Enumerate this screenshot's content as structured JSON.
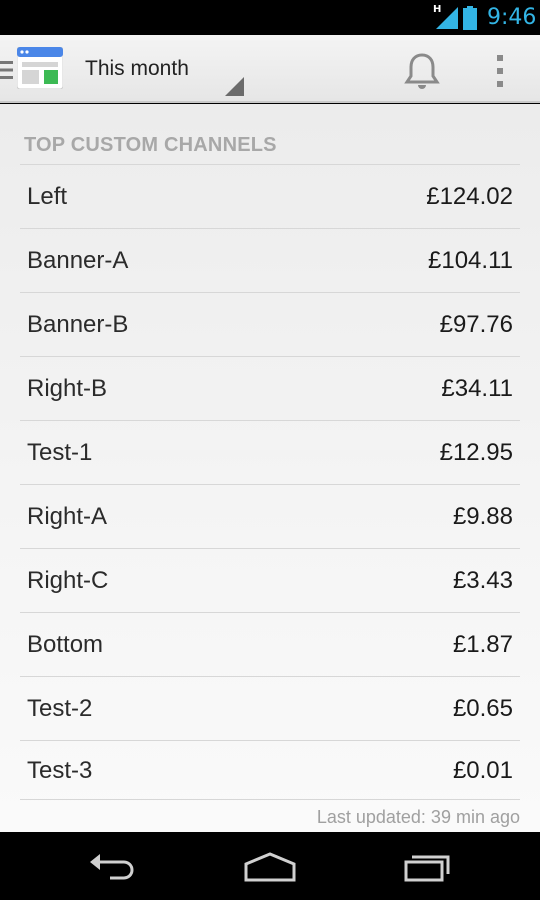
{
  "status_bar": {
    "network_type": "H",
    "time": "9:46",
    "icons": [
      "signal-icon",
      "battery-icon"
    ]
  },
  "action_bar": {
    "period": "This month",
    "icons": [
      "drawer-indicator-icon",
      "adsense-app-icon",
      "spinner-arrow-icon",
      "bell-icon",
      "overflow-menu-icon"
    ]
  },
  "section": {
    "title": "TOP CUSTOM CHANNELS",
    "rows": [
      {
        "name": "Left",
        "value": "£124.02"
      },
      {
        "name": "Banner-A",
        "value": "£104.11"
      },
      {
        "name": "Banner-B",
        "value": "£97.76"
      },
      {
        "name": "Right-B",
        "value": "£34.11"
      },
      {
        "name": "Test-1",
        "value": "£12.95"
      },
      {
        "name": "Right-A",
        "value": "£9.88"
      },
      {
        "name": "Right-C",
        "value": "£3.43"
      },
      {
        "name": "Bottom",
        "value": "£1.87"
      },
      {
        "name": "Test-2",
        "value": "£0.65"
      },
      {
        "name": "Test-3",
        "value": "£0.01"
      }
    ],
    "last_updated": "Last updated: 39 min ago"
  },
  "nav_bar": {
    "icons": [
      "back-icon",
      "home-icon",
      "recent-apps-icon"
    ]
  },
  "colors": {
    "status_accent": "#33b5e5",
    "section_header": "#a8a8a8",
    "app_icon_blue": "#4a86e8",
    "app_icon_green": "#3cba54"
  }
}
